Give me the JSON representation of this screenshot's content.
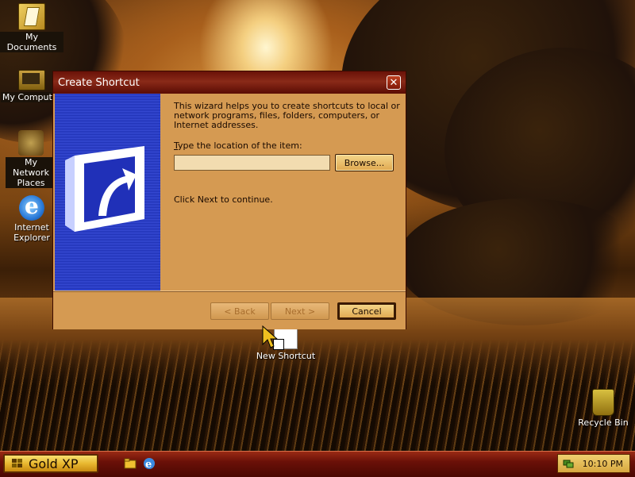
{
  "desktop": {
    "icons": [
      {
        "label": "My Documents",
        "icon": "my-documents-icon"
      },
      {
        "label": "My Computer",
        "icon": "my-computer-icon"
      },
      {
        "label": "My Network Places",
        "icon": "network-places-icon"
      },
      {
        "label": "Internet Explorer",
        "icon": "internet-explorer-icon"
      },
      {
        "label": "New Shortcut",
        "icon": "shortcut-file-icon"
      },
      {
        "label": "Recycle Bin",
        "icon": "recycle-bin-icon"
      }
    ]
  },
  "dialog": {
    "title": "Create Shortcut",
    "close_symbol": "✕",
    "intro": "This wizard helps you to create shortcuts to local or network programs, files, folders, computers, or Internet addresses.",
    "location_label_prefix": "",
    "location_label_accel": "T",
    "location_label_rest": "ype the location of the item:",
    "location_value": "",
    "browse_label": "Browse...",
    "continue_text": "Click Next to continue.",
    "back_label": "< Back",
    "next_label": "Next >",
    "cancel_label": "Cancel"
  },
  "taskbar": {
    "start_label": "Gold XP",
    "clock": "10:10 PM",
    "quick_launch": [
      "folder-icon",
      "internet-explorer-icon"
    ]
  },
  "colors": {
    "titlebar": "#6a1208",
    "dialog_bg": "#d59a52",
    "side_panel": "#2a3ec8",
    "taskbar": "#6a1008",
    "start_button": "#e8b830"
  }
}
